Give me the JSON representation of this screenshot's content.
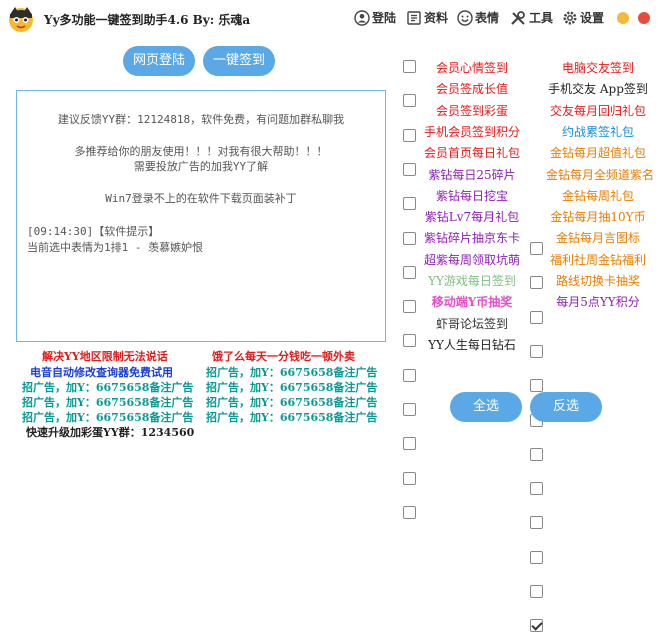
{
  "window": {
    "title": "Yy多功能一键签到助手4.6  By: 乐魂a"
  },
  "toolbar": {
    "login": "登陆",
    "data": "资料",
    "emoji": "表情",
    "tools": "工具",
    "settings": "设置"
  },
  "buttons": {
    "web_login": "网页登陆",
    "one_click_sign": "一键签到",
    "select_all": "全选",
    "invert": "反选"
  },
  "log": {
    "line1": "建议反馈YY群：12124818，软件免费，有问题加群私聊我",
    "line2": "多推荐给你的朋友使用！！！对我有很大帮助！！！",
    "line3": "需要投放广告的加我YY了解",
    "line4": "Win7登录不上的在软件下载页面装补丁",
    "line5": "[09:14:30]【软件提示】",
    "line6": "当前选中表情为1排1 - 羡慕嫉妒恨"
  },
  "ads": {
    "a1": "解决YY地区限制无法说话",
    "a2": "饿了么每天一分钱吃一顿外卖",
    "a3": "电音自动修改查询器免费试用",
    "a4": "招广告，加Y：6675658备注广告",
    "a5": "招广告，加Y：6675658备注广告",
    "a6": "招广告，加Y：6675658备注广告",
    "a7": "招广告，加Y：6675658备注广告",
    "a8": "招广告，加Y：6675658备注广告",
    "a9": "招广告，加Y：6675658备注广告",
    "a10": "快速升级加彩蛋YY群：1234560",
    "a11": "招广告，加Y：6675658备注广告"
  },
  "tasks_left": [
    {
      "label": "会员心情签到",
      "color": "#e31b1b",
      "checked": false
    },
    {
      "label": "会员签成长值",
      "color": "#e31b1b",
      "checked": false
    },
    {
      "label": "会员签到彩蛋",
      "color": "#e31b1b",
      "checked": false
    },
    {
      "label": "手机会员签到积分",
      "color": "#e31b1b",
      "checked": false
    },
    {
      "label": "会员首页每日礼包",
      "color": "#e31b1b",
      "checked": false
    },
    {
      "label": "紫钻每日25碎片",
      "color": "#8e1fb5",
      "checked": false
    },
    {
      "label": "紫钻每日挖宝",
      "color": "#8e1fb5",
      "checked": false
    },
    {
      "label": "紫钻Lv7每月礼包",
      "color": "#8e1fb5",
      "checked": false
    },
    {
      "label": "紫钻碎片抽京东卡",
      "color": "#8e1fb5",
      "checked": false
    },
    {
      "label": "超紫每周领取坑萌",
      "color": "#8e1fb5",
      "checked": false
    },
    {
      "label": "YY游戏每日签到",
      "color": "#7fbf7f",
      "checked": false
    },
    {
      "label": "移动端Y币抽奖",
      "color": "#e64ec9",
      "checked": false
    },
    {
      "label": "虾哥论坛签到",
      "color": "#333333",
      "checked": false
    },
    {
      "label": "YY人生每日钻石",
      "color": "#222222",
      "checked": false
    }
  ],
  "tasks_right": [
    {
      "label": "电脑交友签到",
      "color": "#e31b1b",
      "checked": false
    },
    {
      "label": "手机交友 App签到",
      "color": "#222222",
      "checked": false
    },
    {
      "label": "交友每月回归礼包",
      "color": "#e31b1b",
      "checked": false
    },
    {
      "label": "约战累签礼包",
      "color": "#1a8fd8",
      "checked": false
    },
    {
      "label": "金钻每月超值礼包",
      "color": "#e67e00",
      "checked": false
    },
    {
      "label": "金钻每月全频道紫名",
      "color": "#e67e00",
      "checked": false
    },
    {
      "label": "金钻每周礼包",
      "color": "#e67e00",
      "checked": false
    },
    {
      "label": "金钻每月抽10Y币",
      "color": "#e67e00",
      "checked": false
    },
    {
      "label": "金钻每月言图标",
      "color": "#e67e00",
      "checked": false
    },
    {
      "label": "福利社周金钻福利",
      "color": "#e67e00",
      "checked": false
    },
    {
      "label": "路线切换卡抽奖",
      "color": "#e67e00",
      "checked": false
    },
    {
      "label": "每月5点YY积分",
      "color": "#8e1fb5",
      "checked": true
    }
  ]
}
